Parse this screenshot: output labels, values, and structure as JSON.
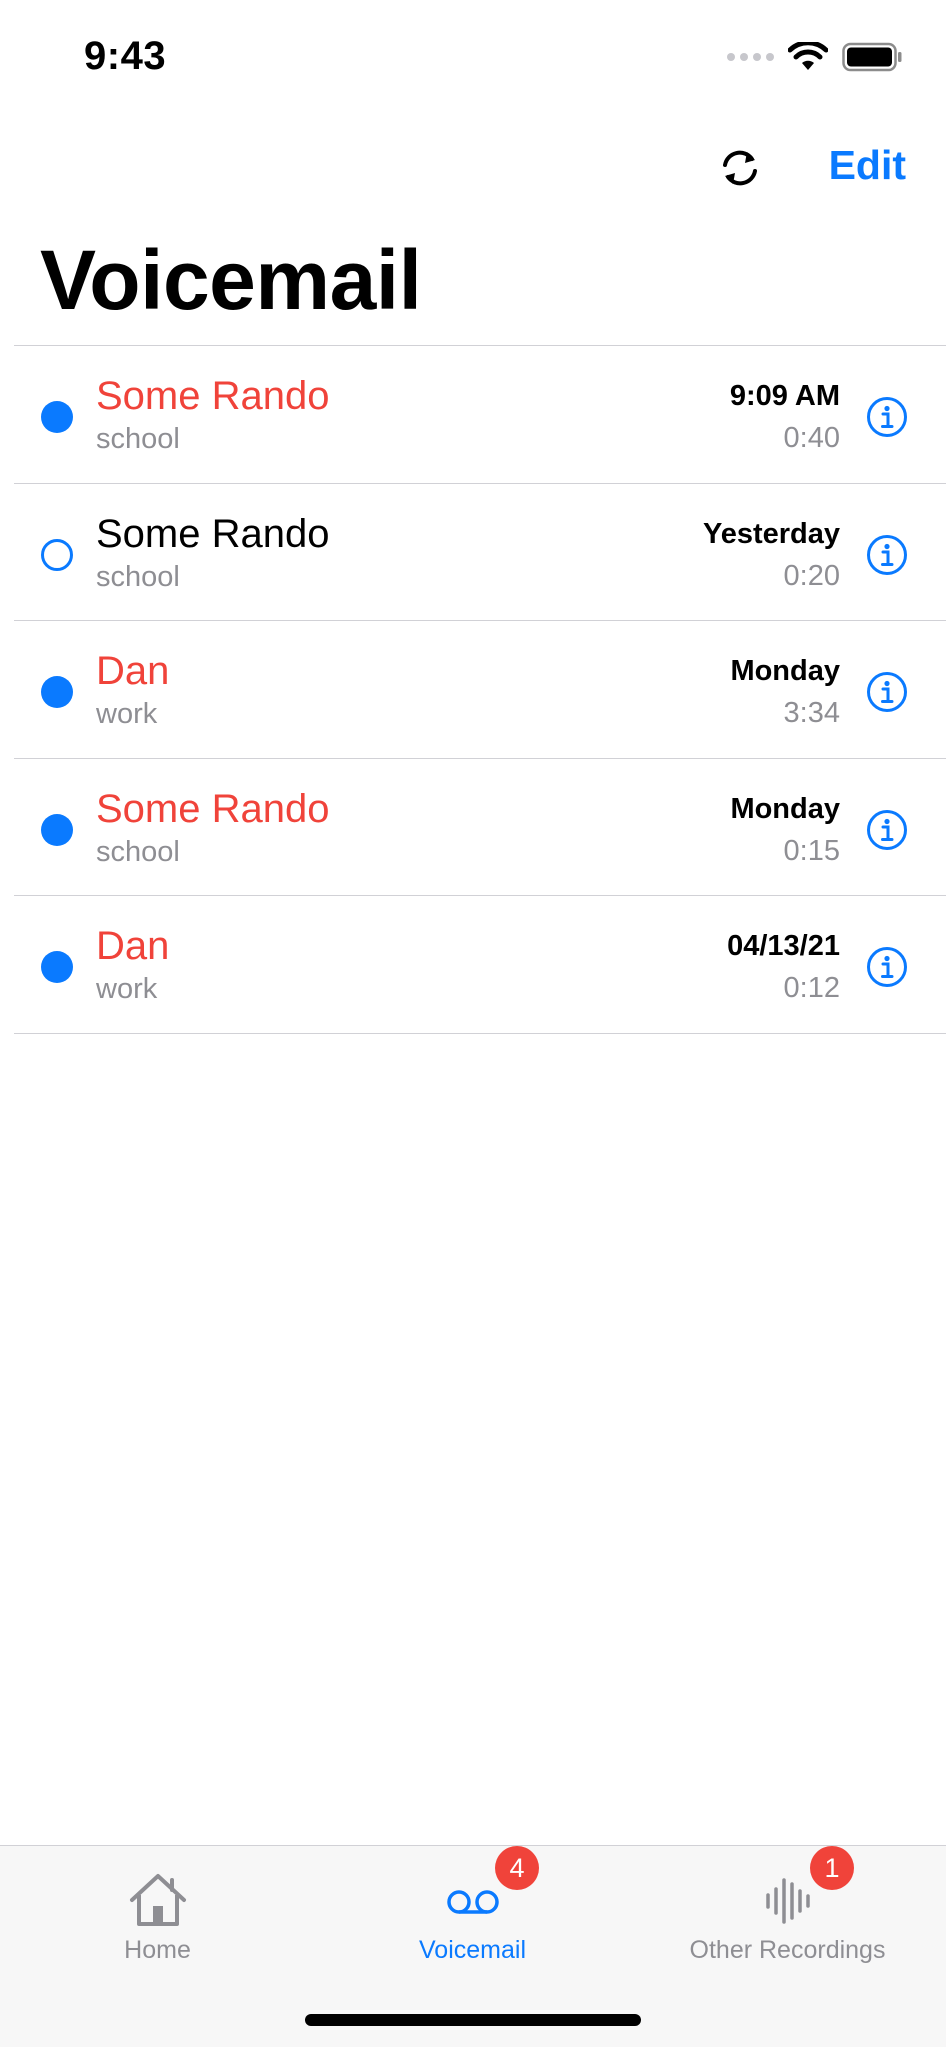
{
  "status_bar": {
    "time": "9:43"
  },
  "nav": {
    "refresh_icon": "refresh-icon",
    "edit_label": "Edit"
  },
  "page_title": "Voicemail",
  "voicemails": [
    {
      "name": "Some Rando",
      "label": "school",
      "time": "9:09 AM",
      "duration": "0:40",
      "unread": true
    },
    {
      "name": "Some Rando",
      "label": "school",
      "time": "Yesterday",
      "duration": "0:20",
      "unread": false
    },
    {
      "name": "Dan",
      "label": "work",
      "time": "Monday",
      "duration": "3:34",
      "unread": true
    },
    {
      "name": "Some Rando",
      "label": "school",
      "time": "Monday",
      "duration": "0:15",
      "unread": true
    },
    {
      "name": "Dan",
      "label": "work",
      "time": "04/13/21",
      "duration": "0:12",
      "unread": true
    }
  ],
  "tabs": [
    {
      "label": "Home",
      "icon": "house-icon",
      "active": false,
      "badge": ""
    },
    {
      "label": "Voicemail",
      "icon": "voicemail-icon",
      "active": true,
      "badge": "4"
    },
    {
      "label": "Other Recordings",
      "icon": "waveform-icon",
      "active": false,
      "badge": "1"
    }
  ],
  "colors": {
    "accent": "#0a7aff",
    "unread_name": "#f0433a",
    "secondary_text": "#8e8e93",
    "badge": "#f0433a"
  }
}
